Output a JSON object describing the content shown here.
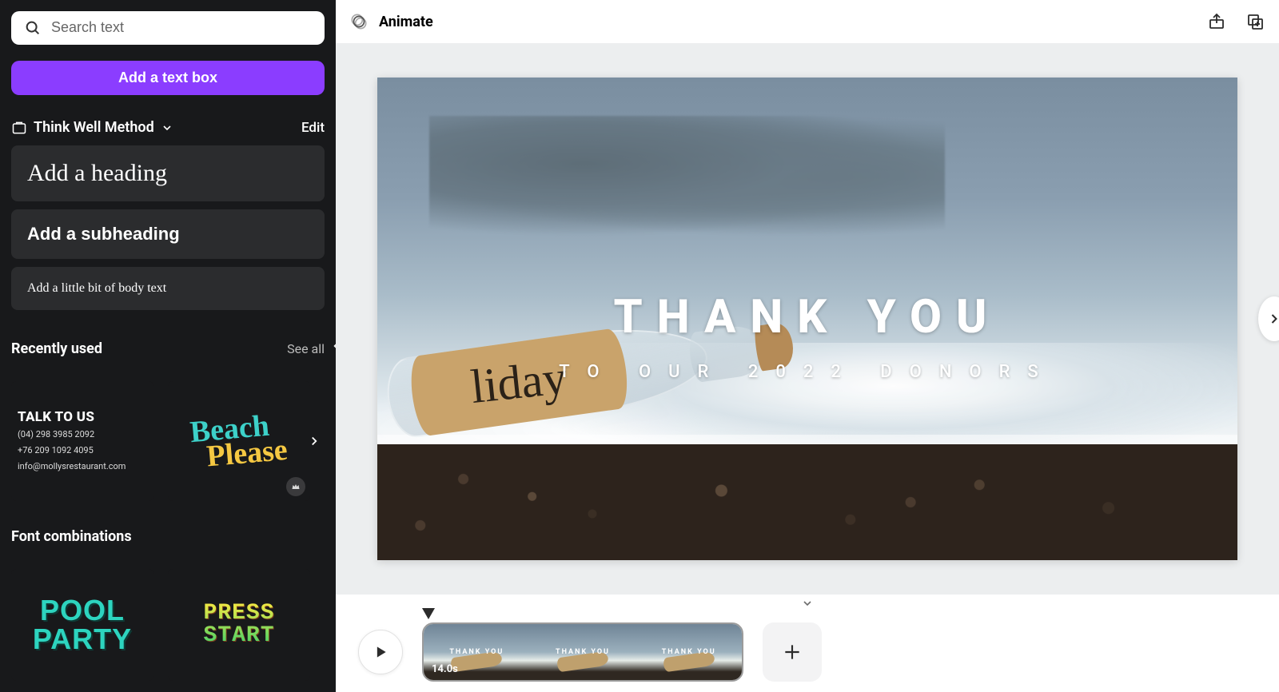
{
  "sidebar": {
    "search_placeholder": "Search text",
    "add_text_box": "Add a text box",
    "brand_kit": "Think Well Method",
    "edit": "Edit",
    "styles": {
      "heading": "Add a heading",
      "subheading": "Add a subheading",
      "body": "Add a little bit of body text"
    },
    "recently_used": {
      "title": "Recently used",
      "see_all": "See all",
      "items": [
        {
          "line1": "TALK TO US",
          "line2": "(04) 298 3985 2092",
          "line3": "+76 209 1092 4095",
          "line4": "info@mollysrestaurant.com"
        },
        {
          "line1": "Beach",
          "line2": "Please"
        }
      ]
    },
    "font_combinations": {
      "title": "Font combinations",
      "items": [
        {
          "line1": "POOL",
          "line2": "PARTY"
        },
        {
          "line1": "PRESS",
          "line2": "START"
        }
      ]
    }
  },
  "topbar": {
    "animate": "Animate"
  },
  "canvas": {
    "title": "THANK YOU",
    "subtitle": "TO OUR 2022 DONORS",
    "bottle_label": "liday"
  },
  "timeline": {
    "duration": "14.0s",
    "thumb_title": "THANK YOU"
  }
}
